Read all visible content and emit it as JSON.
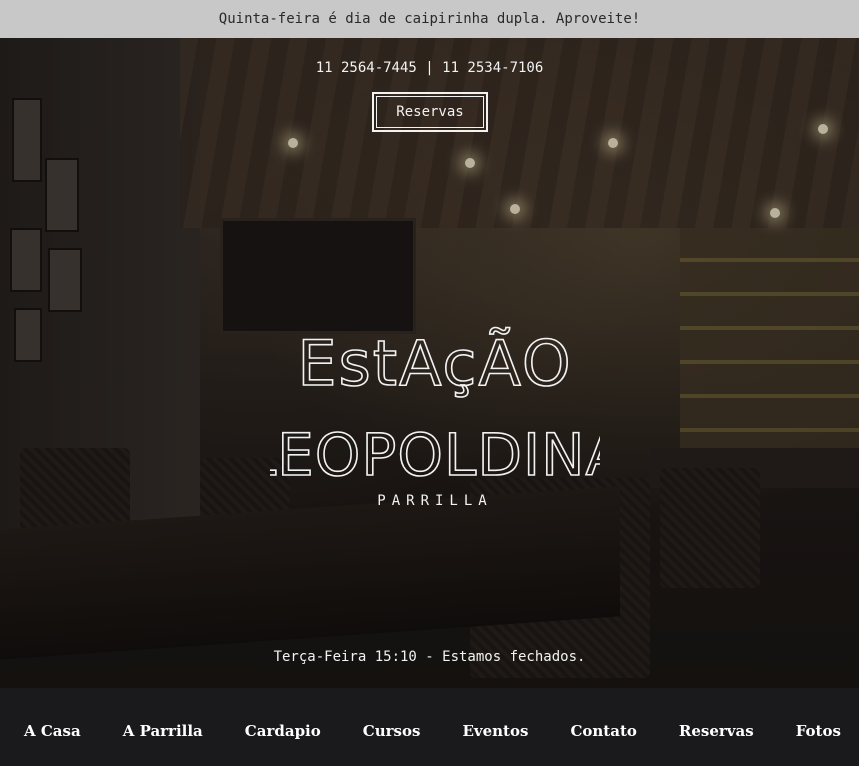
{
  "announcement": "Quinta-feira é dia de caipirinha dupla. Aproveite!",
  "hero": {
    "phones": "11 2564-7445 | 11 2534-7106",
    "reserve_label": "Reservas",
    "logo": {
      "line1": "EstAçÃO",
      "line2": "LEOPOLDINA",
      "tagline": "PARRILLA"
    },
    "status": "Terça-Feira 15:10 - Estamos fechados."
  },
  "nav": {
    "items": [
      "A Casa",
      "A Parrilla",
      "Cardapio",
      "Cursos",
      "Eventos",
      "Contato",
      "Reservas",
      "Fotos"
    ]
  },
  "colors": {
    "topbar_bg": "#c8c8c8",
    "nav_bg": "#1a1a1c",
    "text_light": "#f2f2f2"
  }
}
